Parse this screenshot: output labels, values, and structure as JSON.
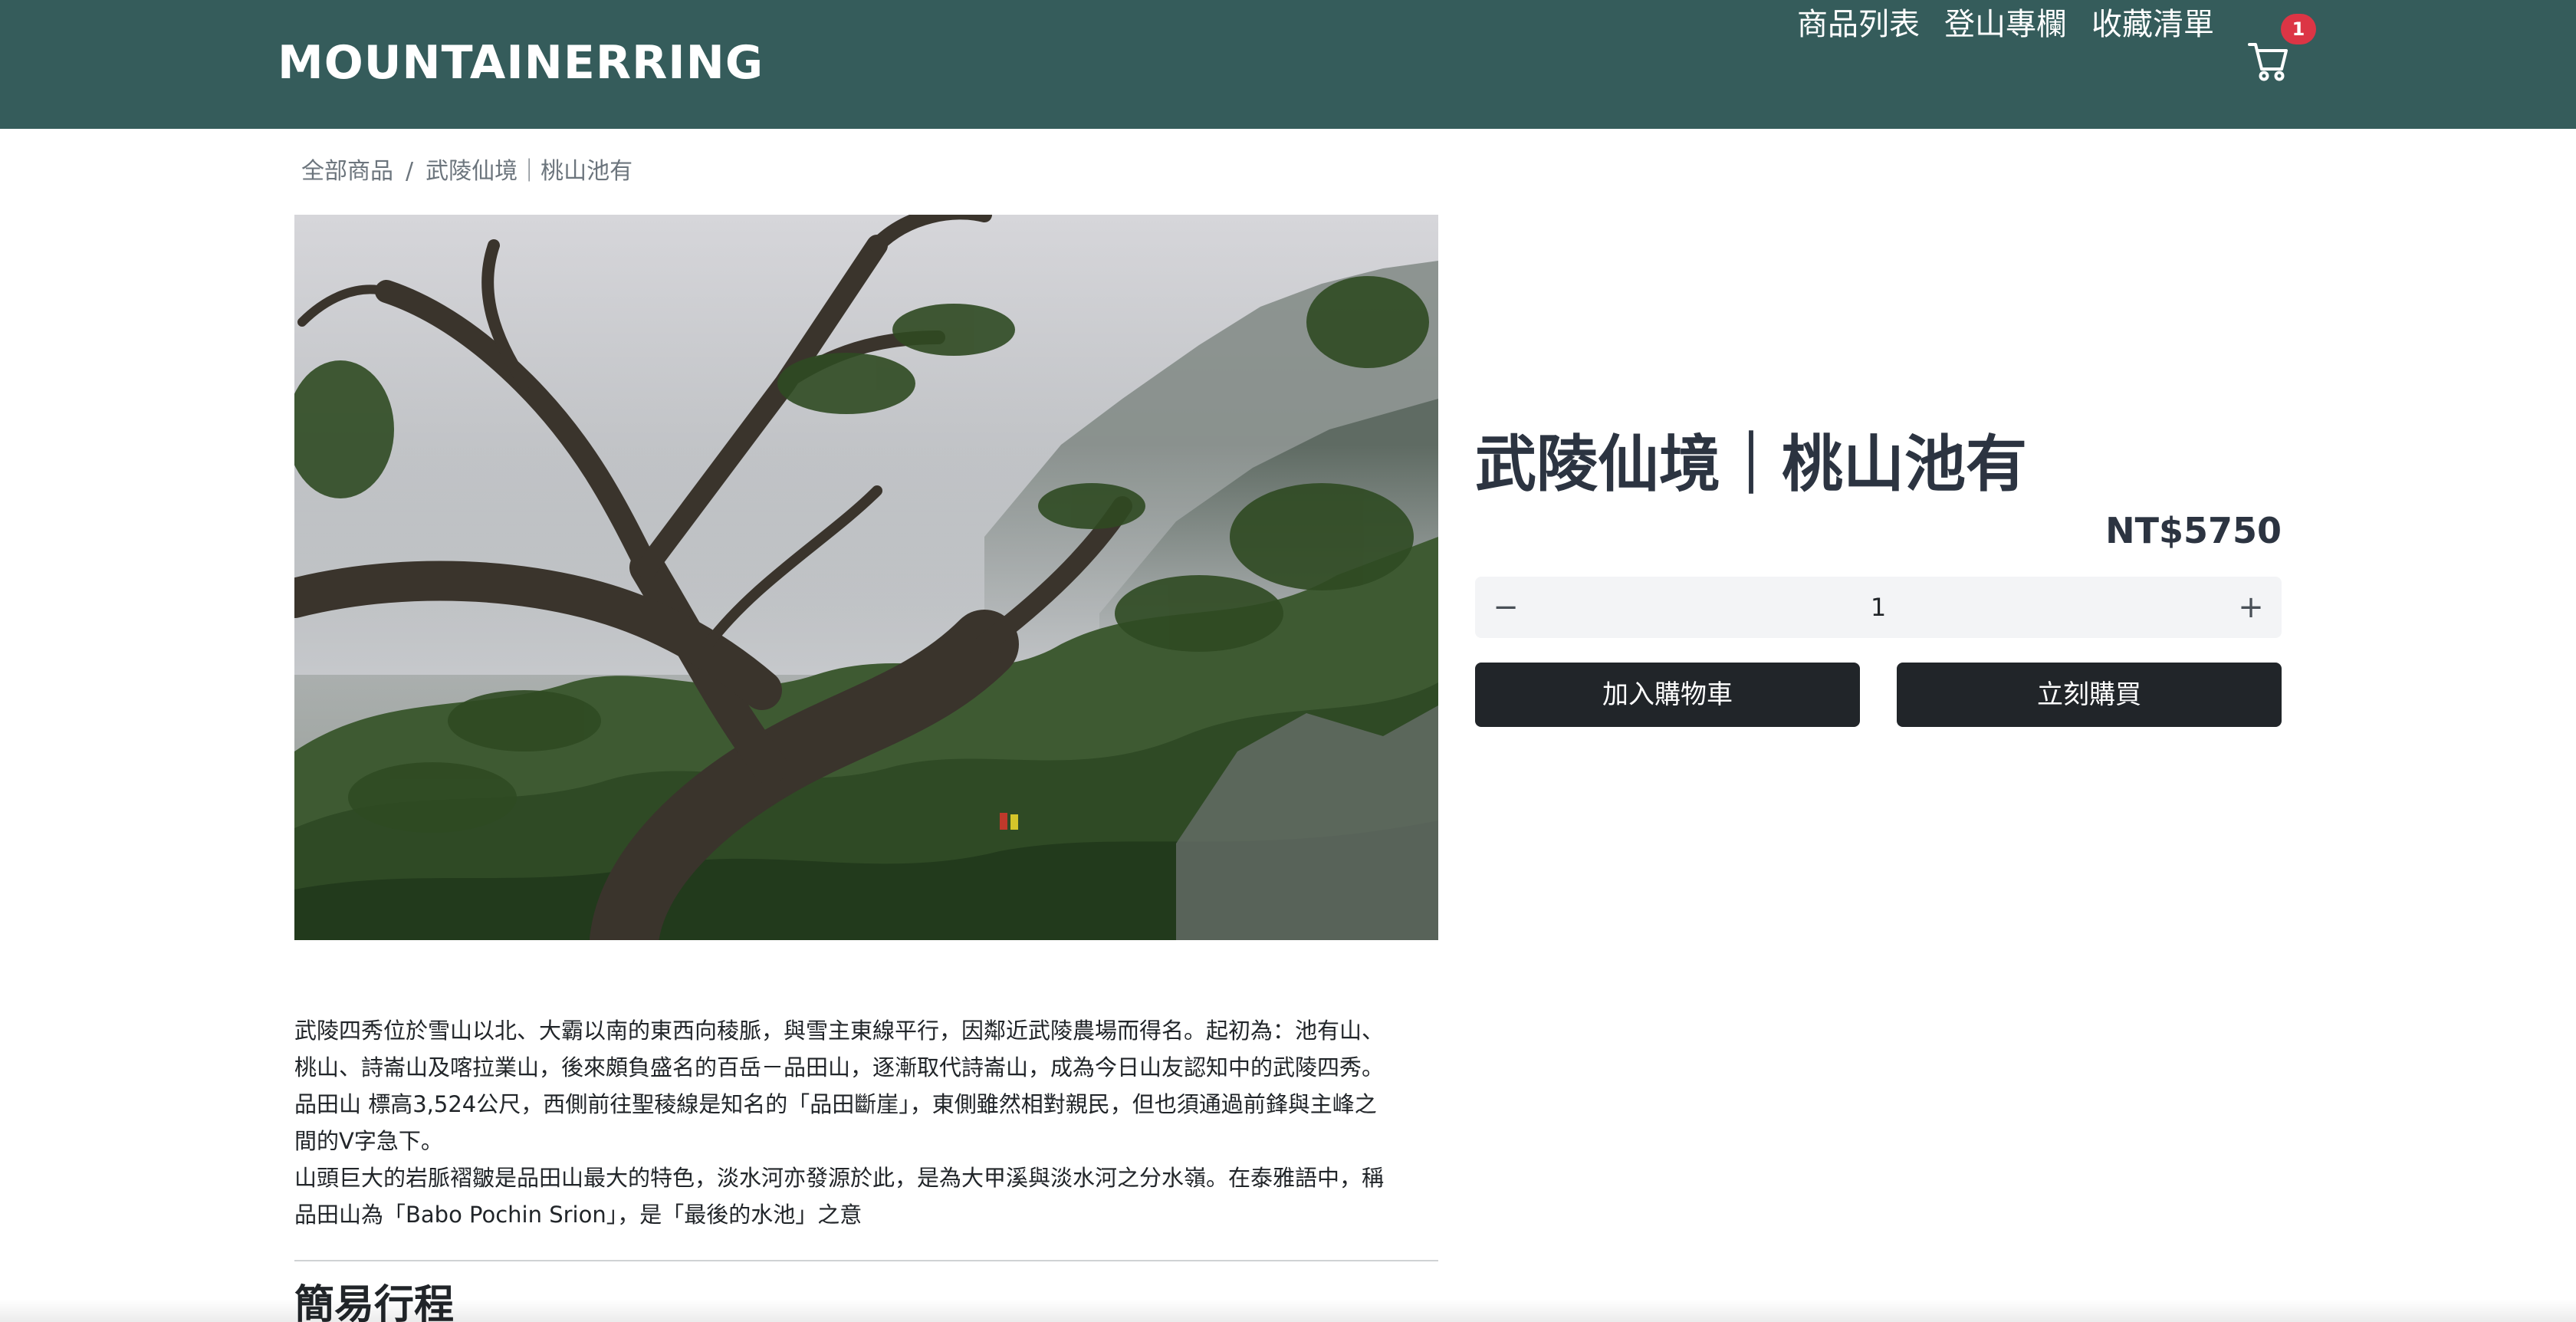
{
  "navbar": {
    "brand": "MOUNTAINERRING",
    "links": [
      "商品列表",
      "登山專欄",
      "收藏清單"
    ],
    "cart_count": "1",
    "cart_icon": "cart-icon",
    "background": "#355c5b"
  },
  "breadcrumb": {
    "items": [
      "全部商品",
      "武陵仙境｜桃山池有"
    ],
    "separator": "/"
  },
  "product": {
    "title": "武陵仙境｜桃山池有",
    "price": "NT$5750",
    "quantity": "1",
    "minus_label": "−",
    "plus_label": "+",
    "add_to_cart": "加入購物車",
    "buy_now": "立刻購買",
    "image_alt": "misty mountain forest with gnarled tree and hikers"
  },
  "description": {
    "lines": [
      "武陵四秀位於雪山以北、大霸以南的東西向稜脈，與雪主東線平行，因鄰近武陵農場而得名。起初為：池有山、",
      "桃山、詩崙山及喀拉業山，後來頗負盛名的百岳－品田山，逐漸取代詩崙山，成為今日山友認知中的武陵四秀。",
      "品田山 標高3,524公尺，西側前往聖稜線是知名的「品田斷崖」，東側雖然相對親民，但也須通過前鋒與主峰之",
      "間的V字急下。",
      "山頭巨大的岩脈褶皺是品田山最大的特色，淡水河亦發源於此，是為大甲溪與淡水河之分水嶺。在泰雅語中，稱",
      "品田山為「Babo Pochin Srion」，是「最後的水池」之意"
    ]
  },
  "itinerary": {
    "title": "簡易行程"
  }
}
